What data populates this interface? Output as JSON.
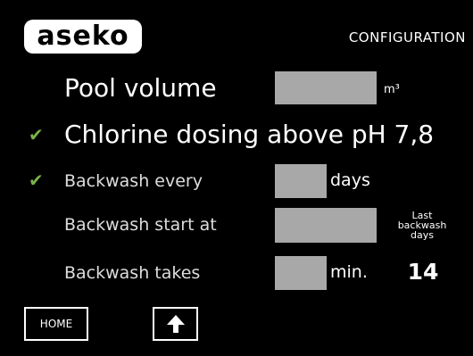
{
  "header": {
    "logo_text": "aseko",
    "screen_title": "CONFIGURATION"
  },
  "settings": {
    "pool_volume": {
      "label": "Pool volume",
      "value": "",
      "unit": "m³"
    },
    "chlorine_dosing": {
      "label": "Chlorine dosing above pH 7,8",
      "checked": true
    },
    "backwash_every": {
      "label": "Backwash every",
      "value": "",
      "unit": "days",
      "checked": true
    },
    "backwash_start": {
      "label": "Backwash start at",
      "value": ""
    },
    "backwash_takes": {
      "label": "Backwash takes",
      "value": "",
      "unit": "min."
    }
  },
  "last_backwash": {
    "label_line1": "Last",
    "label_line2": "backwash",
    "label_line3": "days",
    "value": "14"
  },
  "buttons": {
    "home_label": "HOME",
    "up_icon": "arrow-up-icon"
  },
  "colors": {
    "background": "#000000",
    "field": "#a8a8a8",
    "check": "#7ab24a",
    "text": "#ffffff"
  },
  "icons": {
    "check": "✔"
  }
}
